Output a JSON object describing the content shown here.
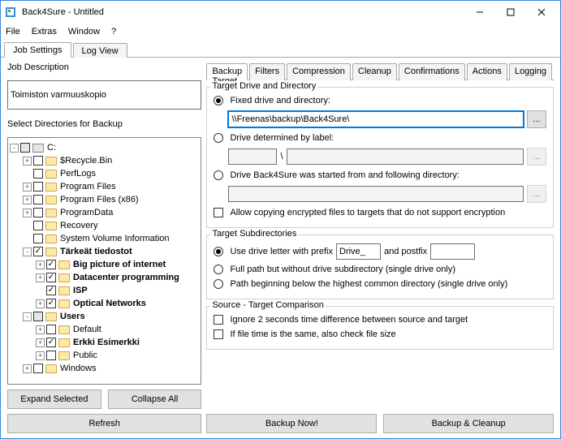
{
  "window": {
    "title": "Back4Sure - Untitled"
  },
  "menu": [
    "File",
    "Extras",
    "Window",
    "?"
  ],
  "main_tabs": [
    "Job Settings",
    "Log View"
  ],
  "right_tabs": [
    "Backup Target",
    "Filters",
    "Compression",
    "Cleanup",
    "Confirmations",
    "Actions",
    "Logging"
  ],
  "left": {
    "job_desc_label": "Job Description",
    "job_desc_value": "Toimiston varmuuskopio",
    "select_dirs_label": "Select Directories for Backup",
    "expand_btn": "Expand Selected",
    "collapse_btn": "Collapse All",
    "refresh_btn": "Refresh"
  },
  "tree": [
    {
      "depth": 0,
      "exp": "-",
      "cb": "mx",
      "icon": "drv",
      "label": "C:",
      "bold": false
    },
    {
      "depth": 1,
      "exp": "+",
      "cb": "",
      "icon": "fld",
      "label": "$Recycle.Bin"
    },
    {
      "depth": 1,
      "exp": " ",
      "cb": "",
      "icon": "fld",
      "label": "PerfLogs"
    },
    {
      "depth": 1,
      "exp": "+",
      "cb": "",
      "icon": "fld",
      "label": "Program Files"
    },
    {
      "depth": 1,
      "exp": "+",
      "cb": "",
      "icon": "fld",
      "label": "Program Files (x86)"
    },
    {
      "depth": 1,
      "exp": "+",
      "cb": "",
      "icon": "fld",
      "label": "ProgramData"
    },
    {
      "depth": 1,
      "exp": " ",
      "cb": "",
      "icon": "fld",
      "label": "Recovery"
    },
    {
      "depth": 1,
      "exp": " ",
      "cb": "",
      "icon": "fld",
      "label": "System Volume Information"
    },
    {
      "depth": 1,
      "exp": "-",
      "cb": "ck",
      "icon": "fld",
      "label": "Tärkeät tiedostot",
      "bold": true
    },
    {
      "depth": 2,
      "exp": "+",
      "cb": "ck",
      "icon": "fld",
      "label": "Big picture of internet",
      "bold": true
    },
    {
      "depth": 2,
      "exp": "+",
      "cb": "ck",
      "icon": "fld",
      "label": "Datacenter programming",
      "bold": true
    },
    {
      "depth": 2,
      "exp": " ",
      "cb": "ck",
      "icon": "fld",
      "label": "ISP",
      "bold": true
    },
    {
      "depth": 2,
      "exp": "+",
      "cb": "ck",
      "icon": "fld",
      "label": "Optical Networks",
      "bold": true
    },
    {
      "depth": 1,
      "exp": "-",
      "cb": "mx",
      "icon": "fld",
      "label": "Users",
      "bold": true
    },
    {
      "depth": 2,
      "exp": "+",
      "cb": "",
      "icon": "fld",
      "label": "Default"
    },
    {
      "depth": 2,
      "exp": "+",
      "cb": "ck",
      "icon": "fld",
      "label": "Erkki Esimerkki",
      "bold": true
    },
    {
      "depth": 2,
      "exp": "+",
      "cb": "",
      "icon": "fld",
      "label": "Public"
    },
    {
      "depth": 1,
      "exp": "+",
      "cb": "",
      "icon": "fld",
      "label": "Windows"
    }
  ],
  "target": {
    "group1_title": "Target Drive and Directory",
    "fixed_label": "Fixed drive and directory:",
    "fixed_value": "\\\\Freenas\\backup\\Back4Sure\\",
    "label_label": "Drive determined by label:",
    "started_label": "Drive Back4Sure was started from and following directory:",
    "allow_encrypted": "Allow copying encrypted files to targets that do not support encryption",
    "group2_title": "Target Subdirectories",
    "prefix_label": "Use drive letter with prefix",
    "prefix_value": "Drive_",
    "postfix_label": "and postfix",
    "fullpath_label": "Full path but without drive subdirectory (single drive only)",
    "common_label": "Path beginning below the highest common directory (single drive only)",
    "group3_title": "Source - Target Comparison",
    "ignore2s": "Ignore 2 seconds time difference between source and target",
    "checksize": "If file time is the same, also check file size"
  },
  "footer": {
    "backup_now": "Backup Now!",
    "backup_cleanup": "Backup & Cleanup"
  }
}
